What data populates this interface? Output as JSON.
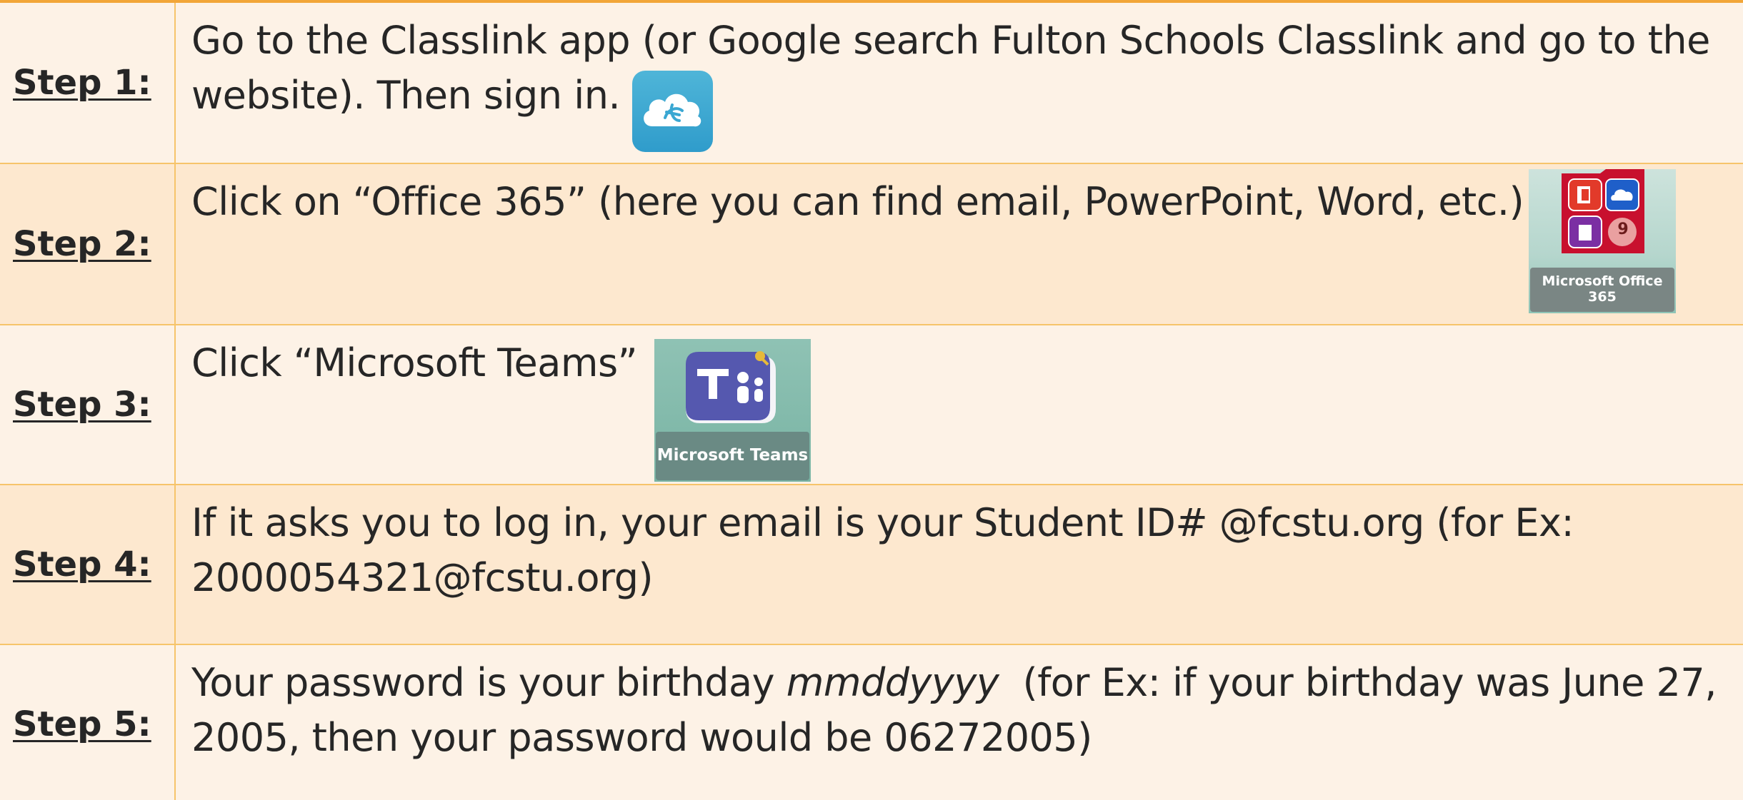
{
  "steps": [
    {
      "label": "Step 1:",
      "lines": [
        "Go to the Classlink app (or Google search Fulton Schools Classlink and go to the",
        "website). Then sign in."
      ],
      "icon": "classlink-app-icon"
    },
    {
      "label": "Step 2:",
      "lines": [
        "Click on “Office 365” (here you can find email, PowerPoint, Word, etc.)"
      ],
      "icon": "microsoft-office-365-tile",
      "icon_caption_1": "Microsoft Office",
      "icon_caption_2": "365",
      "icon_badge": "9"
    },
    {
      "label": "Step 3:",
      "lines": [
        "Click “Microsoft Teams”"
      ],
      "icon": "microsoft-teams-tile",
      "icon_caption": "Microsoft Teams"
    },
    {
      "label": "Step 4:",
      "lines": [
        "If it asks you to log in, your email is your Student ID# @fcstu.org  (for Ex:",
        "2000054321@fcstu.org)"
      ]
    },
    {
      "label": "Step 5:",
      "line1_prefix": "Your password is your birthday ",
      "line1_italic": "mmddyyyy",
      "line1_suffix": "  (for Ex: if your birthday was June 27,",
      "line2": "2005, then your password would be 06272005)"
    }
  ],
  "colors": {
    "row_light": "#fdf2e6",
    "row_dark": "#fde8cf",
    "border": "#f6c46a",
    "top_border": "#f2a638",
    "text": "#262626",
    "classlink_blue": "#3aa7d2",
    "office_red": "#c8102e",
    "teams_purple": "#5558af"
  }
}
